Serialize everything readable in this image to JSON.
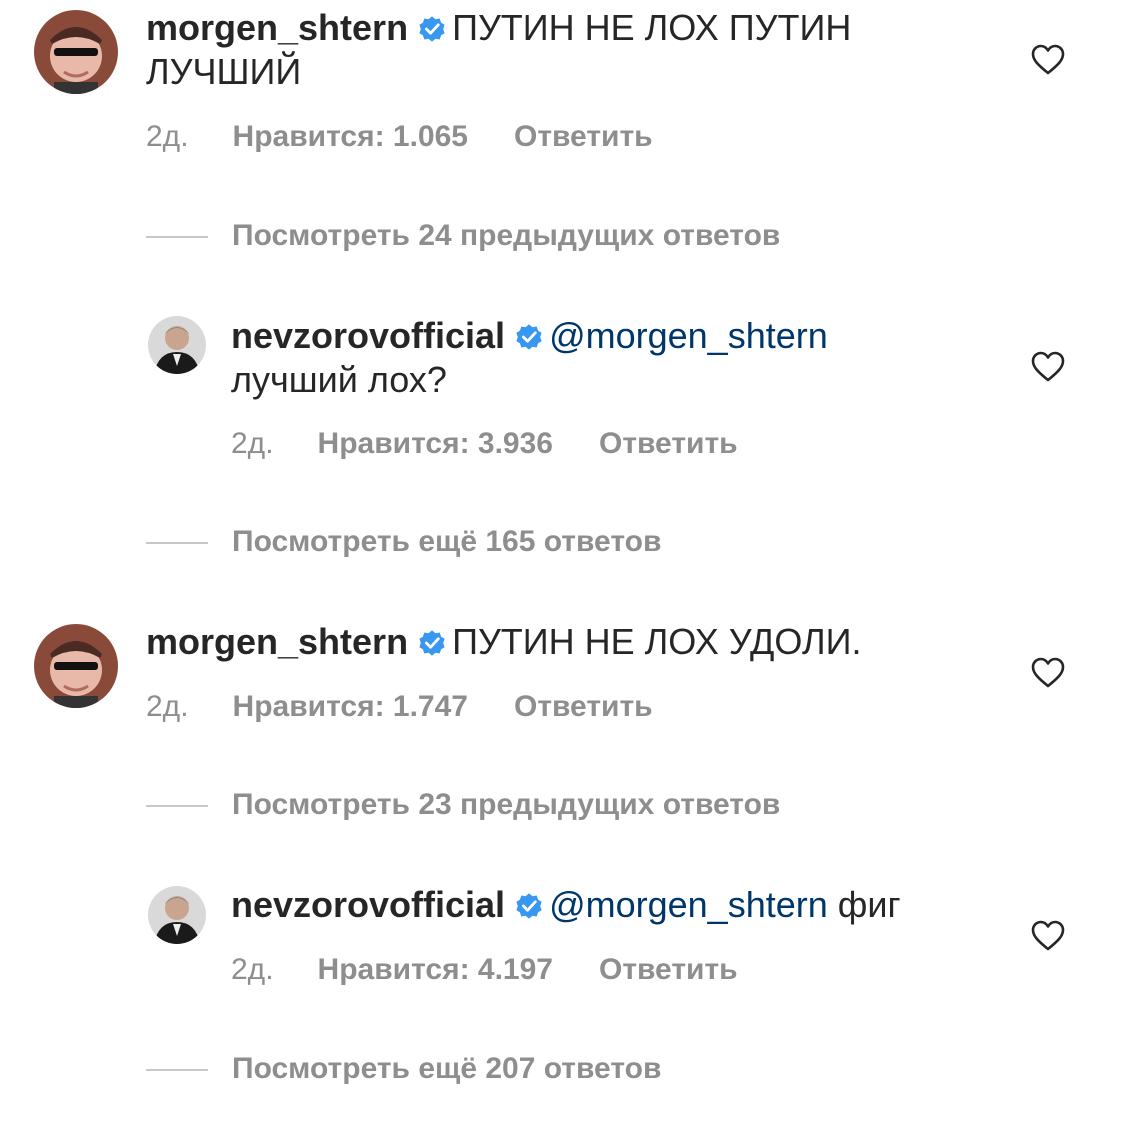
{
  "comments": [
    {
      "username": "morgen_shtern",
      "mention": "",
      "text_line1": "ПУТИН НЕ ЛОХ ПУТИН",
      "text_line2": "ЛУЧШИЙ",
      "time": "2д.",
      "likes": "Нравится: 1.065",
      "reply": "Ответить",
      "view_more": "Посмотреть 24 предыдущих ответов"
    },
    {
      "username": "nevzorovofficial",
      "mention": "@morgen_shtern",
      "text_line1": "",
      "text_line2": "лучший лох?",
      "time": "2д.",
      "likes": "Нравится: 3.936",
      "reply": "Ответить",
      "view_more": "Посмотреть ещё 165 ответов"
    },
    {
      "username": "morgen_shtern",
      "mention": "",
      "text_line1": "ПУТИН НЕ ЛОХ УДОЛИ.",
      "time": "2д.",
      "likes": "Нравится: 1.747",
      "reply": "Ответить",
      "view_more": "Посмотреть 23 предыдущих ответов"
    },
    {
      "username": "nevzorovofficial",
      "mention": "@morgen_shtern",
      "text_line1": "фиг",
      "time": "2д.",
      "likes": "Нравится: 4.197",
      "reply": "Ответить",
      "view_more": "Посмотреть ещё 207 ответов"
    }
  ],
  "icons": {
    "verified": "verified-badge-icon",
    "like": "heart-icon"
  },
  "colors": {
    "verified_blue": "#3897f0",
    "muted_text": "#8e8e8e",
    "primary_text": "#262626",
    "mention_blue": "#00376b"
  }
}
